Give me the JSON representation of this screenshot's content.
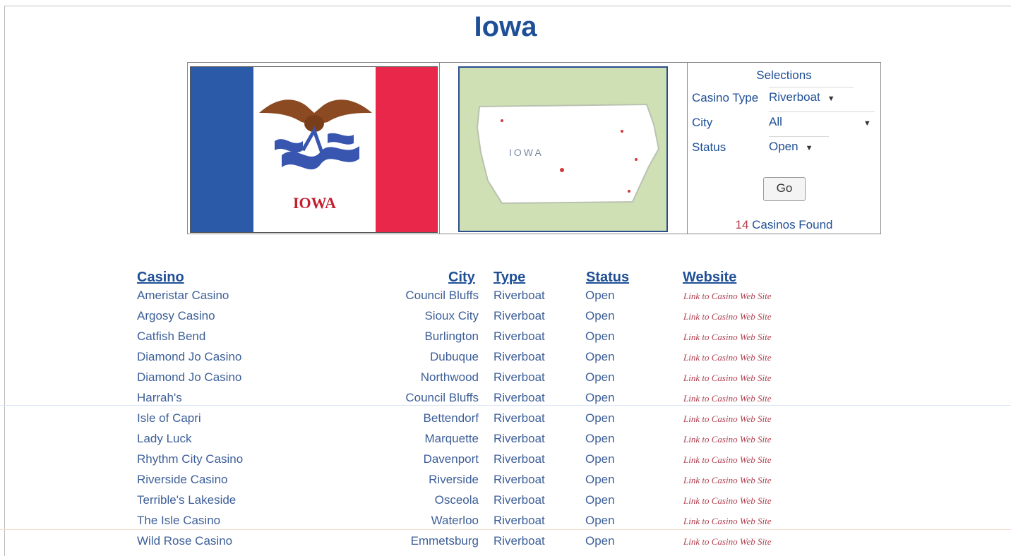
{
  "page": {
    "title": "Iowa"
  },
  "flag": {
    "text": "IOWA"
  },
  "map": {
    "label": "IOWA"
  },
  "selections": {
    "heading": "Selections",
    "casino_type_label": "Casino Type",
    "casino_type_value": "Riverboat",
    "city_label": "City",
    "city_value": "All",
    "status_label": "Status",
    "status_value": "Open",
    "go_label": "Go",
    "found_count": "14",
    "found_suffix": "Casinos Found"
  },
  "table": {
    "headers": {
      "casino": "Casino",
      "city": "City",
      "type": "Type",
      "status": "Status",
      "website": "Website"
    },
    "rows": [
      {
        "casino": "Ameristar Casino",
        "city": "Council Bluffs",
        "type": "Riverboat",
        "status": "Open",
        "link": "Link to Casino Web Site"
      },
      {
        "casino": "Argosy Casino",
        "city": "Sioux City",
        "type": "Riverboat",
        "status": "Open",
        "link": "Link to Casino Web Site"
      },
      {
        "casino": "Catfish Bend",
        "city": "Burlington",
        "type": "Riverboat",
        "status": "Open",
        "link": "Link to Casino Web Site"
      },
      {
        "casino": "Diamond Jo Casino",
        "city": "Dubuque",
        "type": "Riverboat",
        "status": "Open",
        "link": "Link to Casino Web Site"
      },
      {
        "casino": "Diamond Jo Casino",
        "city": "Northwood",
        "type": "Riverboat",
        "status": "Open",
        "link": "Link to Casino Web Site"
      },
      {
        "casino": "Harrah's",
        "city": "Council Bluffs",
        "type": "Riverboat",
        "status": "Open",
        "link": "Link to Casino Web Site"
      },
      {
        "casino": "Isle of Capri",
        "city": "Bettendorf",
        "type": "Riverboat",
        "status": "Open",
        "link": "Link to Casino Web Site"
      },
      {
        "casino": "Lady Luck",
        "city": "Marquette",
        "type": "Riverboat",
        "status": "Open",
        "link": "Link to Casino Web Site"
      },
      {
        "casino": "Rhythm City Casino",
        "city": "Davenport",
        "type": "Riverboat",
        "status": "Open",
        "link": "Link to Casino Web Site"
      },
      {
        "casino": "Riverside Casino",
        "city": "Riverside",
        "type": "Riverboat",
        "status": "Open",
        "link": "Link to Casino Web Site"
      },
      {
        "casino": "Terrible's Lakeside",
        "city": "Osceola",
        "type": "Riverboat",
        "status": "Open",
        "link": "Link to Casino Web Site"
      },
      {
        "casino": "The Isle Casino",
        "city": "Waterloo",
        "type": "Riverboat",
        "status": "Open",
        "link": "Link to Casino Web Site"
      },
      {
        "casino": "Wild Rose Casino",
        "city": "Emmetsburg",
        "type": "Riverboat",
        "status": "Open",
        "link": "Link to Casino Web Site"
      }
    ]
  },
  "colors": {
    "accent": "#1f4f96",
    "link": "#b04050",
    "flag_blue": "#2a5aa8",
    "flag_red": "#e8274a"
  }
}
